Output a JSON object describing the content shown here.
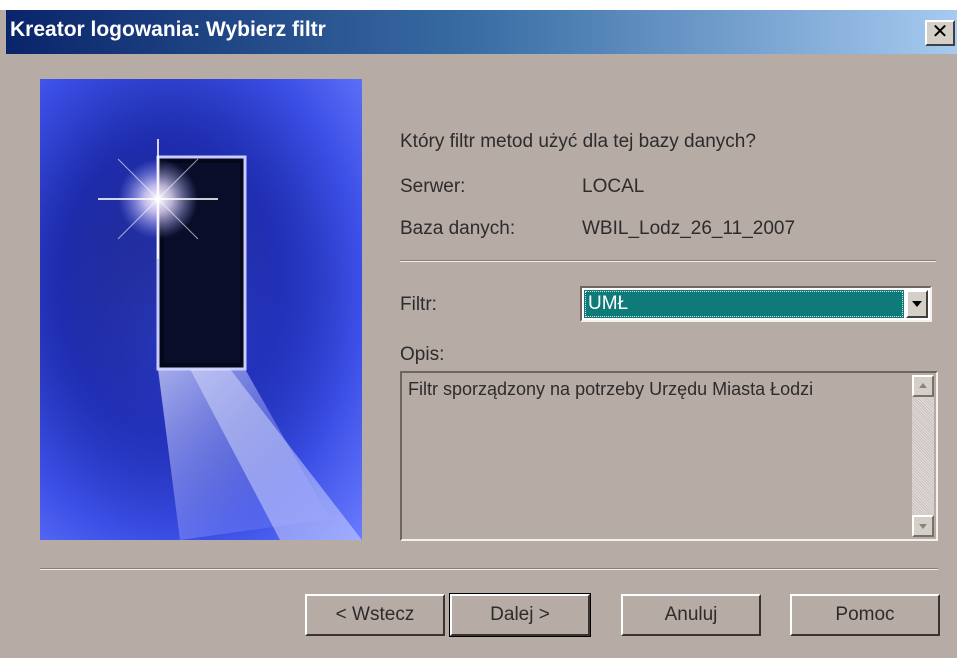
{
  "window": {
    "title": "Kreator logowania: Wybierz filtr",
    "close_glyph": "✕"
  },
  "content": {
    "question": "Który filtr metod użyć dla tej bazy danych?",
    "server_label": "Serwer:",
    "server_value": "LOCAL",
    "database_label": "Baza danych:",
    "database_value": "WBIL_Lodz_26_11_2007",
    "filter_label": "Filtr:",
    "filter_value": "UMŁ",
    "description_label": "Opis:",
    "description_text": "Filtr sporządzony na potrzeby Urzędu Miasta Łodzi"
  },
  "buttons": {
    "back": "< Wstecz",
    "next": "Dalej >",
    "cancel": "Anuluj",
    "help": "Pomoc"
  },
  "colors": {
    "title_bar_start": "#0a246a",
    "title_bar_end": "#a6caf0",
    "dialog_background": "#b7aba6",
    "selection": "#0f7b78"
  },
  "icons": {
    "dropdown": "chevron-down-icon",
    "close": "close-icon",
    "picture": "door-light-illustration"
  }
}
